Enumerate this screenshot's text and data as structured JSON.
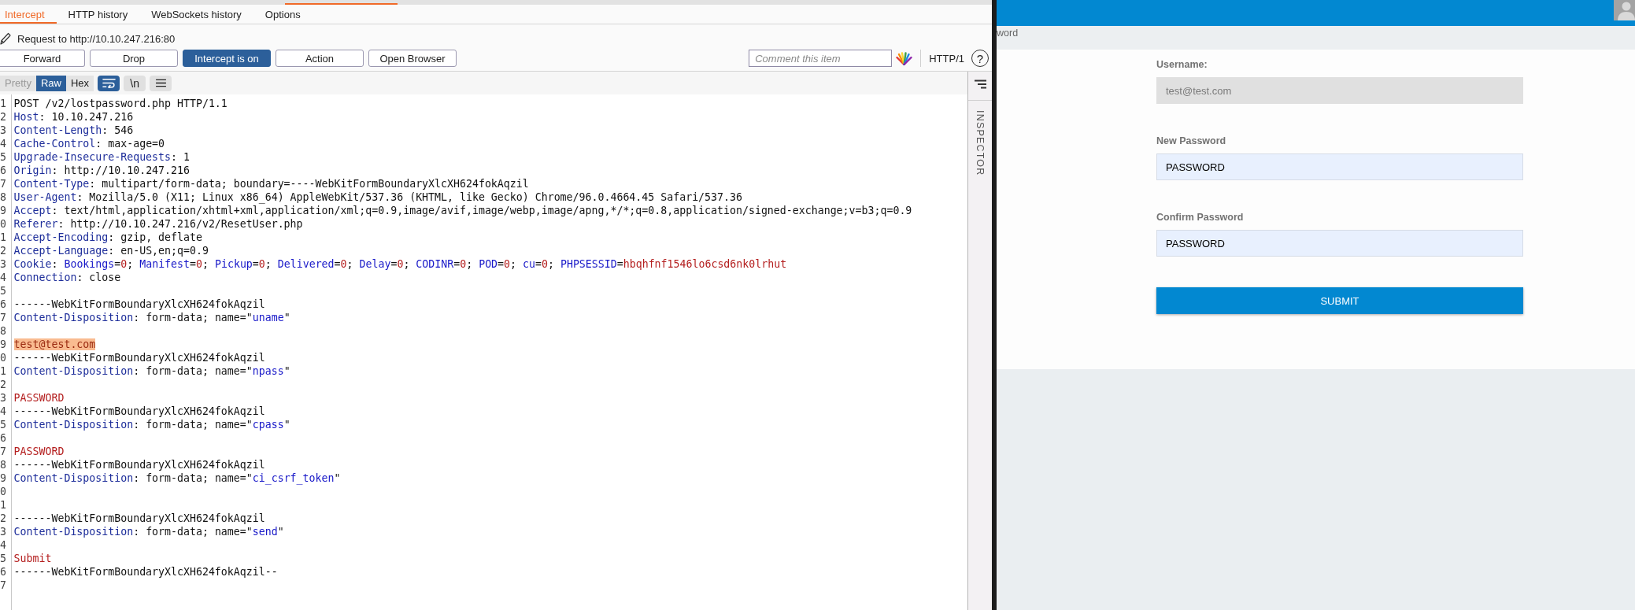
{
  "proxy_tabs": [
    {
      "label": "Intercept",
      "selected": true
    },
    {
      "label": "HTTP history",
      "selected": false
    },
    {
      "label": "WebSockets history",
      "selected": false
    },
    {
      "label": "Options",
      "selected": false
    }
  ],
  "request_target": "Request to http://10.10.247.216:80",
  "actions": [
    {
      "label": "Forward",
      "on": false
    },
    {
      "label": "Drop",
      "on": false
    },
    {
      "label": "Intercept is on",
      "on": true
    },
    {
      "label": "Action",
      "on": false
    },
    {
      "label": "Open Browser",
      "on": false
    }
  ],
  "comment": {
    "placeholder": "Comment this item"
  },
  "protocol": "HTTP/1",
  "help": "?",
  "view_tabs": [
    {
      "label": "Pretty",
      "selected": false,
      "disabled": true
    },
    {
      "label": "Raw",
      "selected": true,
      "disabled": false
    },
    {
      "label": "Hex",
      "selected": false,
      "disabled": false
    }
  ],
  "view_toggles": [
    {
      "kind": "wrap",
      "on": true
    },
    {
      "kind": "text",
      "label": "\\n",
      "on": false
    },
    {
      "kind": "menu",
      "on": false
    }
  ],
  "editor": {
    "lines": [
      {
        "number": "1",
        "segments": [
          {
            "kind": "plain",
            "text": "POST /v2/lostpassword.php HTTP/1.1"
          }
        ]
      },
      {
        "number": "2",
        "segments": [
          {
            "kind": "name",
            "text": "Host"
          },
          {
            "kind": "plain",
            "text": ": 10.10.247.216"
          }
        ]
      },
      {
        "number": "3",
        "segments": [
          {
            "kind": "name",
            "text": "Content-Length"
          },
          {
            "kind": "plain",
            "text": ": 546"
          }
        ]
      },
      {
        "number": "4",
        "segments": [
          {
            "kind": "name",
            "text": "Cache-Control"
          },
          {
            "kind": "plain",
            "text": ": max-age=0"
          }
        ]
      },
      {
        "number": "5",
        "segments": [
          {
            "kind": "name",
            "text": "Upgrade-Insecure-Requests"
          },
          {
            "kind": "plain",
            "text": ": 1"
          }
        ]
      },
      {
        "number": "6",
        "segments": [
          {
            "kind": "name",
            "text": "Origin"
          },
          {
            "kind": "plain",
            "text": ": http://10.10.247.216"
          }
        ]
      },
      {
        "number": "7",
        "segments": [
          {
            "kind": "name",
            "text": "Content-Type"
          },
          {
            "kind": "plain",
            "text": ": multipart/form-data; boundary=----WebKitFormBoundaryXlcXH624fokAqzil"
          }
        ]
      },
      {
        "number": "8",
        "segments": [
          {
            "kind": "name",
            "text": "User-Agent"
          },
          {
            "kind": "plain",
            "text": ": Mozilla/5.0 (X11; Linux x86_64) AppleWebKit/537.36 (KHTML, like Gecko) Chrome/96.0.4664.45 Safari/537.36"
          }
        ]
      },
      {
        "number": "9",
        "segments": [
          {
            "kind": "name",
            "text": "Accept"
          },
          {
            "kind": "plain",
            "text": ": text/html,application/xhtml+xml,application/xml;q=0.9,image/avif,image/webp,image/apng,*/*;q=0.8,application/signed-exchange;v=b3;q=0.9"
          }
        ]
      },
      {
        "number": "0",
        "segments": [
          {
            "kind": "name",
            "text": "Referer"
          },
          {
            "kind": "plain",
            "text": ": http://10.10.247.216/v2/ResetUser.php"
          }
        ]
      },
      {
        "number": "1",
        "segments": [
          {
            "kind": "name",
            "text": "Accept-Encoding"
          },
          {
            "kind": "plain",
            "text": ": gzip, deflate"
          }
        ]
      },
      {
        "number": "2",
        "segments": [
          {
            "kind": "name",
            "text": "Accept-Language"
          },
          {
            "kind": "plain",
            "text": ": en-US,en;q=0.9"
          }
        ]
      },
      {
        "number": "3",
        "segments": [
          {
            "kind": "name",
            "text": "Cookie"
          },
          {
            "kind": "plain",
            "text": ": "
          },
          {
            "kind": "param",
            "text": "Bookings"
          },
          {
            "kind": "plain",
            "text": "="
          },
          {
            "kind": "value",
            "text": "0"
          },
          {
            "kind": "plain",
            "text": "; "
          },
          {
            "kind": "param",
            "text": "Manifest"
          },
          {
            "kind": "plain",
            "text": "="
          },
          {
            "kind": "value",
            "text": "0"
          },
          {
            "kind": "plain",
            "text": "; "
          },
          {
            "kind": "param",
            "text": "Pickup"
          },
          {
            "kind": "plain",
            "text": "="
          },
          {
            "kind": "value",
            "text": "0"
          },
          {
            "kind": "plain",
            "text": "; "
          },
          {
            "kind": "param",
            "text": "Delivered"
          },
          {
            "kind": "plain",
            "text": "="
          },
          {
            "kind": "value",
            "text": "0"
          },
          {
            "kind": "plain",
            "text": "; "
          },
          {
            "kind": "param",
            "text": "Delay"
          },
          {
            "kind": "plain",
            "text": "="
          },
          {
            "kind": "value",
            "text": "0"
          },
          {
            "kind": "plain",
            "text": "; "
          },
          {
            "kind": "param",
            "text": "CODINR"
          },
          {
            "kind": "plain",
            "text": "="
          },
          {
            "kind": "value",
            "text": "0"
          },
          {
            "kind": "plain",
            "text": "; "
          },
          {
            "kind": "param",
            "text": "POD"
          },
          {
            "kind": "plain",
            "text": "="
          },
          {
            "kind": "value",
            "text": "0"
          },
          {
            "kind": "plain",
            "text": "; "
          },
          {
            "kind": "param",
            "text": "cu"
          },
          {
            "kind": "plain",
            "text": "="
          },
          {
            "kind": "value",
            "text": "0"
          },
          {
            "kind": "plain",
            "text": "; "
          },
          {
            "kind": "param",
            "text": "PHPSESSID"
          },
          {
            "kind": "plain",
            "text": "="
          },
          {
            "kind": "value",
            "text": "hbqhfnf1546lo6csd6nk0lrhut"
          }
        ]
      },
      {
        "number": "4",
        "segments": [
          {
            "kind": "name",
            "text": "Connection"
          },
          {
            "kind": "plain",
            "text": ": close"
          }
        ]
      },
      {
        "number": "5"
      },
      {
        "number": "6",
        "segments": [
          {
            "kind": "plain",
            "text": "------WebKitFormBoundaryXlcXH624fokAqzil"
          }
        ]
      },
      {
        "number": "7",
        "segments": [
          {
            "kind": "name",
            "text": "Content-Disposition"
          },
          {
            "kind": "plain",
            "text": ": form-data; name=\""
          },
          {
            "kind": "param",
            "text": "uname"
          },
          {
            "kind": "plain",
            "text": "\""
          }
        ]
      },
      {
        "number": "8"
      },
      {
        "number": "9",
        "segments": [
          {
            "kind": "highlight",
            "text": "test@test.com"
          }
        ]
      },
      {
        "number": "0",
        "segments": [
          {
            "kind": "plain",
            "text": "------WebKitFormBoundaryXlcXH624fokAqzil"
          }
        ]
      },
      {
        "number": "1",
        "segments": [
          {
            "kind": "name",
            "text": "Content-Disposition"
          },
          {
            "kind": "plain",
            "text": ": form-data; name=\""
          },
          {
            "kind": "param",
            "text": "npass"
          },
          {
            "kind": "plain",
            "text": "\""
          }
        ]
      },
      {
        "number": "2"
      },
      {
        "number": "3",
        "segments": [
          {
            "kind": "value",
            "text": "PASSWORD"
          }
        ]
      },
      {
        "number": "4",
        "segments": [
          {
            "kind": "plain",
            "text": "------WebKitFormBoundaryXlcXH624fokAqzil"
          }
        ]
      },
      {
        "number": "5",
        "segments": [
          {
            "kind": "name",
            "text": "Content-Disposition"
          },
          {
            "kind": "plain",
            "text": ": form-data; name=\""
          },
          {
            "kind": "param",
            "text": "cpass"
          },
          {
            "kind": "plain",
            "text": "\""
          }
        ]
      },
      {
        "number": "6"
      },
      {
        "number": "7",
        "segments": [
          {
            "kind": "value",
            "text": "PASSWORD"
          }
        ]
      },
      {
        "number": "8",
        "segments": [
          {
            "kind": "plain",
            "text": "------WebKitFormBoundaryXlcXH624fokAqzil"
          }
        ]
      },
      {
        "number": "9",
        "segments": [
          {
            "kind": "name",
            "text": "Content-Disposition"
          },
          {
            "kind": "plain",
            "text": ": form-data; name=\""
          },
          {
            "kind": "param",
            "text": "ci_csrf_token"
          },
          {
            "kind": "plain",
            "text": "\""
          }
        ]
      },
      {
        "number": "0"
      },
      {
        "number": "1"
      },
      {
        "number": "2",
        "segments": [
          {
            "kind": "plain",
            "text": "------WebKitFormBoundaryXlcXH624fokAqzil"
          }
        ]
      },
      {
        "number": "3",
        "segments": [
          {
            "kind": "name",
            "text": "Content-Disposition"
          },
          {
            "kind": "plain",
            "text": ": form-data; name=\""
          },
          {
            "kind": "param",
            "text": "send"
          },
          {
            "kind": "plain",
            "text": "\""
          }
        ]
      },
      {
        "number": "4"
      },
      {
        "number": "5",
        "segments": [
          {
            "kind": "value",
            "text": "Submit"
          }
        ]
      },
      {
        "number": "6",
        "segments": [
          {
            "kind": "plain",
            "text": "------WebKitFormBoundaryXlcXH624fokAqzil--"
          }
        ]
      },
      {
        "number": "7"
      }
    ]
  },
  "inspector": {
    "title": "INSPECTOR"
  },
  "browser": {
    "breadcrumb": "word",
    "form": {
      "fields": [
        {
          "label": "Username:",
          "value": "test@test.com",
          "disabled": true
        },
        {
          "label": "New Password",
          "value": "PASSWORD",
          "disabled": false
        },
        {
          "label": "Confirm Password",
          "value": "PASSWORD",
          "disabled": false
        }
      ],
      "submit": "SUBMIT"
    }
  }
}
